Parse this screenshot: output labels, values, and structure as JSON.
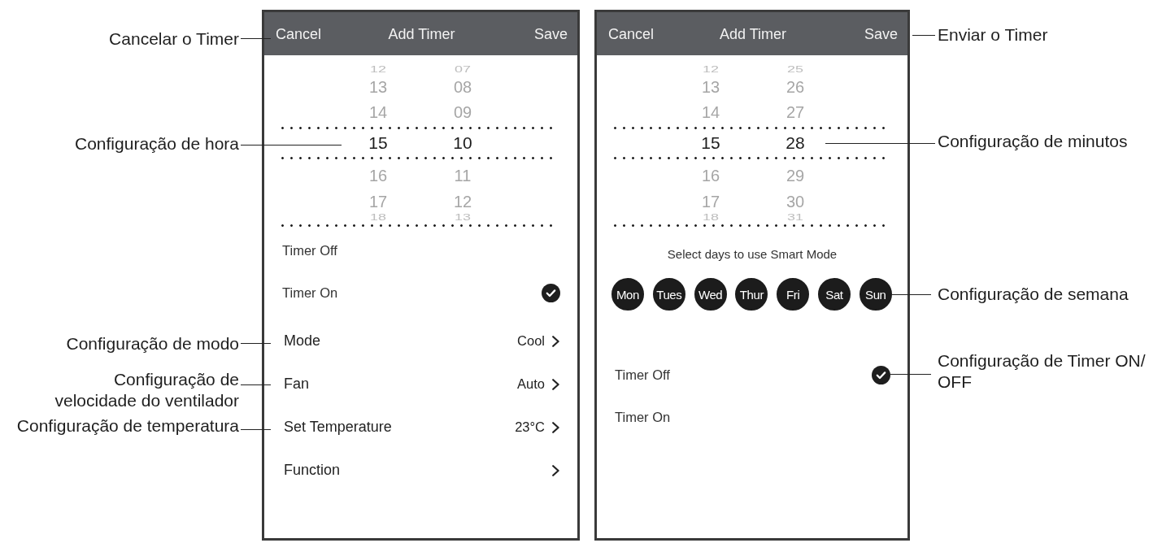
{
  "callouts_left": [
    "Cancelar o Timer",
    "Configuração de hora",
    "Configuração de modo",
    "Configuração de velocidade do ventilador",
    "Configuração de temperatura"
  ],
  "screens": [
    {
      "header": {
        "cancel": "Cancel",
        "title": "Add Timer",
        "save": "Save"
      },
      "picker": {
        "hours": [
          {
            "value": "12",
            "selected": false
          },
          {
            "value": "13",
            "selected": false
          },
          {
            "value": "14",
            "selected": false
          },
          {
            "value": "15",
            "selected": true
          },
          {
            "value": "16",
            "selected": false
          },
          {
            "value": "17",
            "selected": false
          },
          {
            "value": "18",
            "selected": false
          }
        ],
        "minutes": [
          {
            "value": "07",
            "selected": false
          },
          {
            "value": "08",
            "selected": false
          },
          {
            "value": "09",
            "selected": false
          },
          {
            "value": "10",
            "selected": true
          },
          {
            "value": "11",
            "selected": false
          },
          {
            "value": "12",
            "selected": false
          },
          {
            "value": "13",
            "selected": false
          }
        ]
      },
      "timer_options": [
        {
          "label": "Timer Off",
          "selected": false
        },
        {
          "label": "Timer On",
          "selected": true
        }
      ],
      "settings": [
        {
          "label": "Mode",
          "value": "Cool"
        },
        {
          "label": "Fan",
          "value": "Auto"
        },
        {
          "label": "Set Temperature",
          "value": "23°C"
        },
        {
          "label": "Function"
        }
      ]
    },
    {
      "header": {
        "cancel": "Cancel",
        "title": "Add Timer",
        "save": "Save"
      },
      "picker": {
        "hours": [
          {
            "value": "12",
            "selected": false
          },
          {
            "value": "13",
            "selected": false
          },
          {
            "value": "14",
            "selected": false
          },
          {
            "value": "15",
            "selected": true
          },
          {
            "value": "16",
            "selected": false
          },
          {
            "value": "17",
            "selected": false
          },
          {
            "value": "18",
            "selected": false
          }
        ],
        "minutes": [
          {
            "value": "25",
            "selected": false
          },
          {
            "value": "26",
            "selected": false
          },
          {
            "value": "27",
            "selected": false
          },
          {
            "value": "28",
            "selected": true
          },
          {
            "value": "29",
            "selected": false
          },
          {
            "value": "30",
            "selected": false
          },
          {
            "value": "31",
            "selected": false
          }
        ]
      },
      "days_prompt": "Select days to use Smart Mode",
      "days": [
        {
          "label": "Mon",
          "selected": true
        },
        {
          "label": "Tues",
          "selected": true
        },
        {
          "label": "Wed",
          "selected": true
        },
        {
          "label": "Thur",
          "selected": true
        },
        {
          "label": "Fri",
          "selected": true
        },
        {
          "label": "Sat",
          "selected": true
        },
        {
          "label": "Sun",
          "selected": true
        }
      ],
      "timer_options": [
        {
          "label": "Timer Off",
          "selected": true
        },
        {
          "label": "Timer On",
          "selected": false
        }
      ]
    }
  ],
  "callouts_right": [
    "Enviar o Timer",
    "Configuração de minutos",
    "Configuração de semana",
    "Configuração de Timer ON/ OFF"
  ]
}
